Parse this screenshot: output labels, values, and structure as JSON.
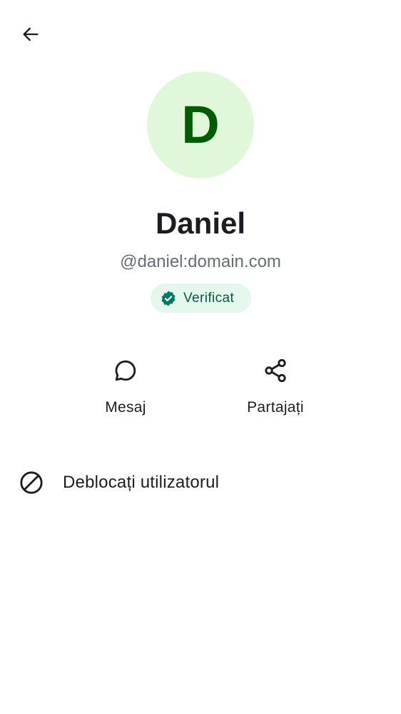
{
  "header": {
    "back_icon": "arrow-left-icon"
  },
  "profile": {
    "avatar_initial": "D",
    "display_name": "Daniel",
    "user_id": "@daniel:domain.com",
    "verified_label": "Verificat",
    "verified_icon": "verified-check-icon"
  },
  "actions": [
    {
      "label": "Mesaj",
      "icon": "chat-bubble-icon"
    },
    {
      "label": "Partajați",
      "icon": "share-icon"
    }
  ],
  "menu": {
    "unblock_label": "Deblocați utilizatorul",
    "unblock_icon": "block-icon"
  },
  "colors": {
    "avatar_bg": "#e0f8d9",
    "avatar_fg": "#005c00",
    "badge_bg": "#e3f7ed",
    "badge_fg": "#005c45",
    "badge_icon": "#007a61",
    "text_primary": "#1b1d22",
    "text_secondary": "#656d77"
  }
}
